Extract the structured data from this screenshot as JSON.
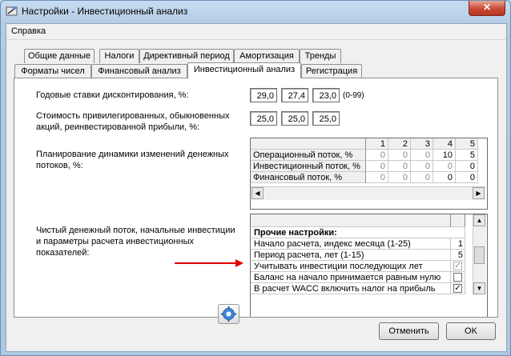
{
  "window": {
    "title": "Настройки - Инвестиционный анализ",
    "close_label": "✕"
  },
  "menu": {
    "help": "Справка"
  },
  "tabs_row1": [
    "Общие данные",
    "Налоги",
    "Директивный период",
    "Амортизация",
    "Тренды"
  ],
  "tabs_row2": [
    "Форматы чисел",
    "Финансовый анализ",
    "Инвестиционный анализ",
    "Регистрация"
  ],
  "active_tab": "Инвестиционный анализ",
  "discount": {
    "label": "Годовые ставки дисконтирования, %:",
    "values": [
      "29,0",
      "27,4",
      "23,0"
    ],
    "range": "(0-99)"
  },
  "capital_cost": {
    "label": "Стоимость привилегированных, обыкновенных акций, реинвестированной прибыли, %:",
    "values": [
      "25,0",
      "25,0",
      "25,0"
    ]
  },
  "cashflow_planning": {
    "label": "Планирование динамики изменений денежных потоков, %:",
    "columns": [
      "1",
      "2",
      "3",
      "4",
      "5"
    ],
    "rows": [
      {
        "name": "Операционный поток, %",
        "values": [
          "0",
          "0",
          "0",
          "10",
          "5"
        ]
      },
      {
        "name": "Инвестиционный поток, %",
        "values": [
          "0",
          "0",
          "0",
          "0",
          "0"
        ]
      },
      {
        "name": "Финансовый поток, %",
        "values": [
          "0",
          "0",
          "0",
          "0",
          "0"
        ]
      }
    ]
  },
  "net_flow": {
    "label": "Чистый денежный поток, начальные инвестиции и параметры расчета инвестиционных показателей:"
  },
  "other_settings": {
    "header": "Прочие настройки:",
    "rows": [
      {
        "name": "Начало расчета, индекс месяца (1-25)",
        "value": "1"
      },
      {
        "name": "Период расчета, лет (1-15)",
        "value": "5"
      },
      {
        "name": "Учитывать инвестиции последующих лет",
        "checked": true,
        "disabled": true
      },
      {
        "name": "Баланс на начало принимается равным нулю",
        "checked": false,
        "disabled": false
      },
      {
        "name": "В расчет WACC включить налог на прибыль",
        "checked": true,
        "disabled": false
      }
    ]
  },
  "buttons": {
    "cancel": "Отменить",
    "ok": "OK"
  },
  "colors": {
    "arrow": "#e00000",
    "titlebar": "#c7dcf2",
    "close": "#c94a34"
  }
}
